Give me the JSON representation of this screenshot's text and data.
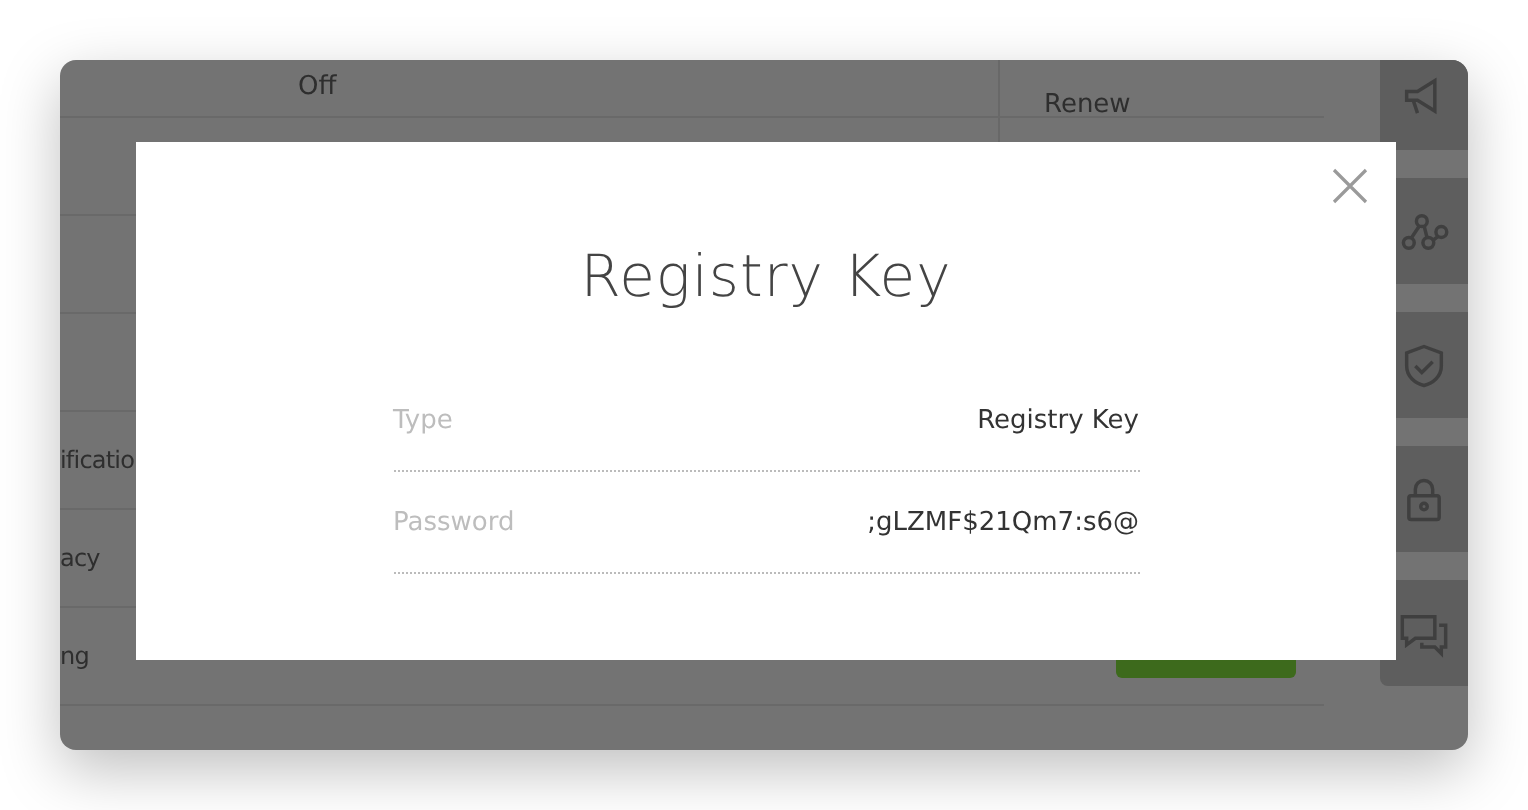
{
  "background_table": {
    "rows": [
      {
        "kind": "text",
        "column_2": "Off",
        "column_3": "Renew"
      },
      {
        "kind": "text"
      },
      {
        "kind": "text"
      },
      {
        "kind": "text"
      },
      {
        "kind": "text",
        "column_1": "ificatio"
      },
      {
        "kind": "text",
        "column_1": "acy"
      },
      {
        "kind": "action",
        "column_1": "ng"
      }
    ]
  },
  "modal": {
    "title": "Registry Key",
    "fields": [
      {
        "label": "Type",
        "value": "Registry Key"
      },
      {
        "label": "Password",
        "value": ";gLZMF$21Qm7:s6@"
      }
    ]
  }
}
